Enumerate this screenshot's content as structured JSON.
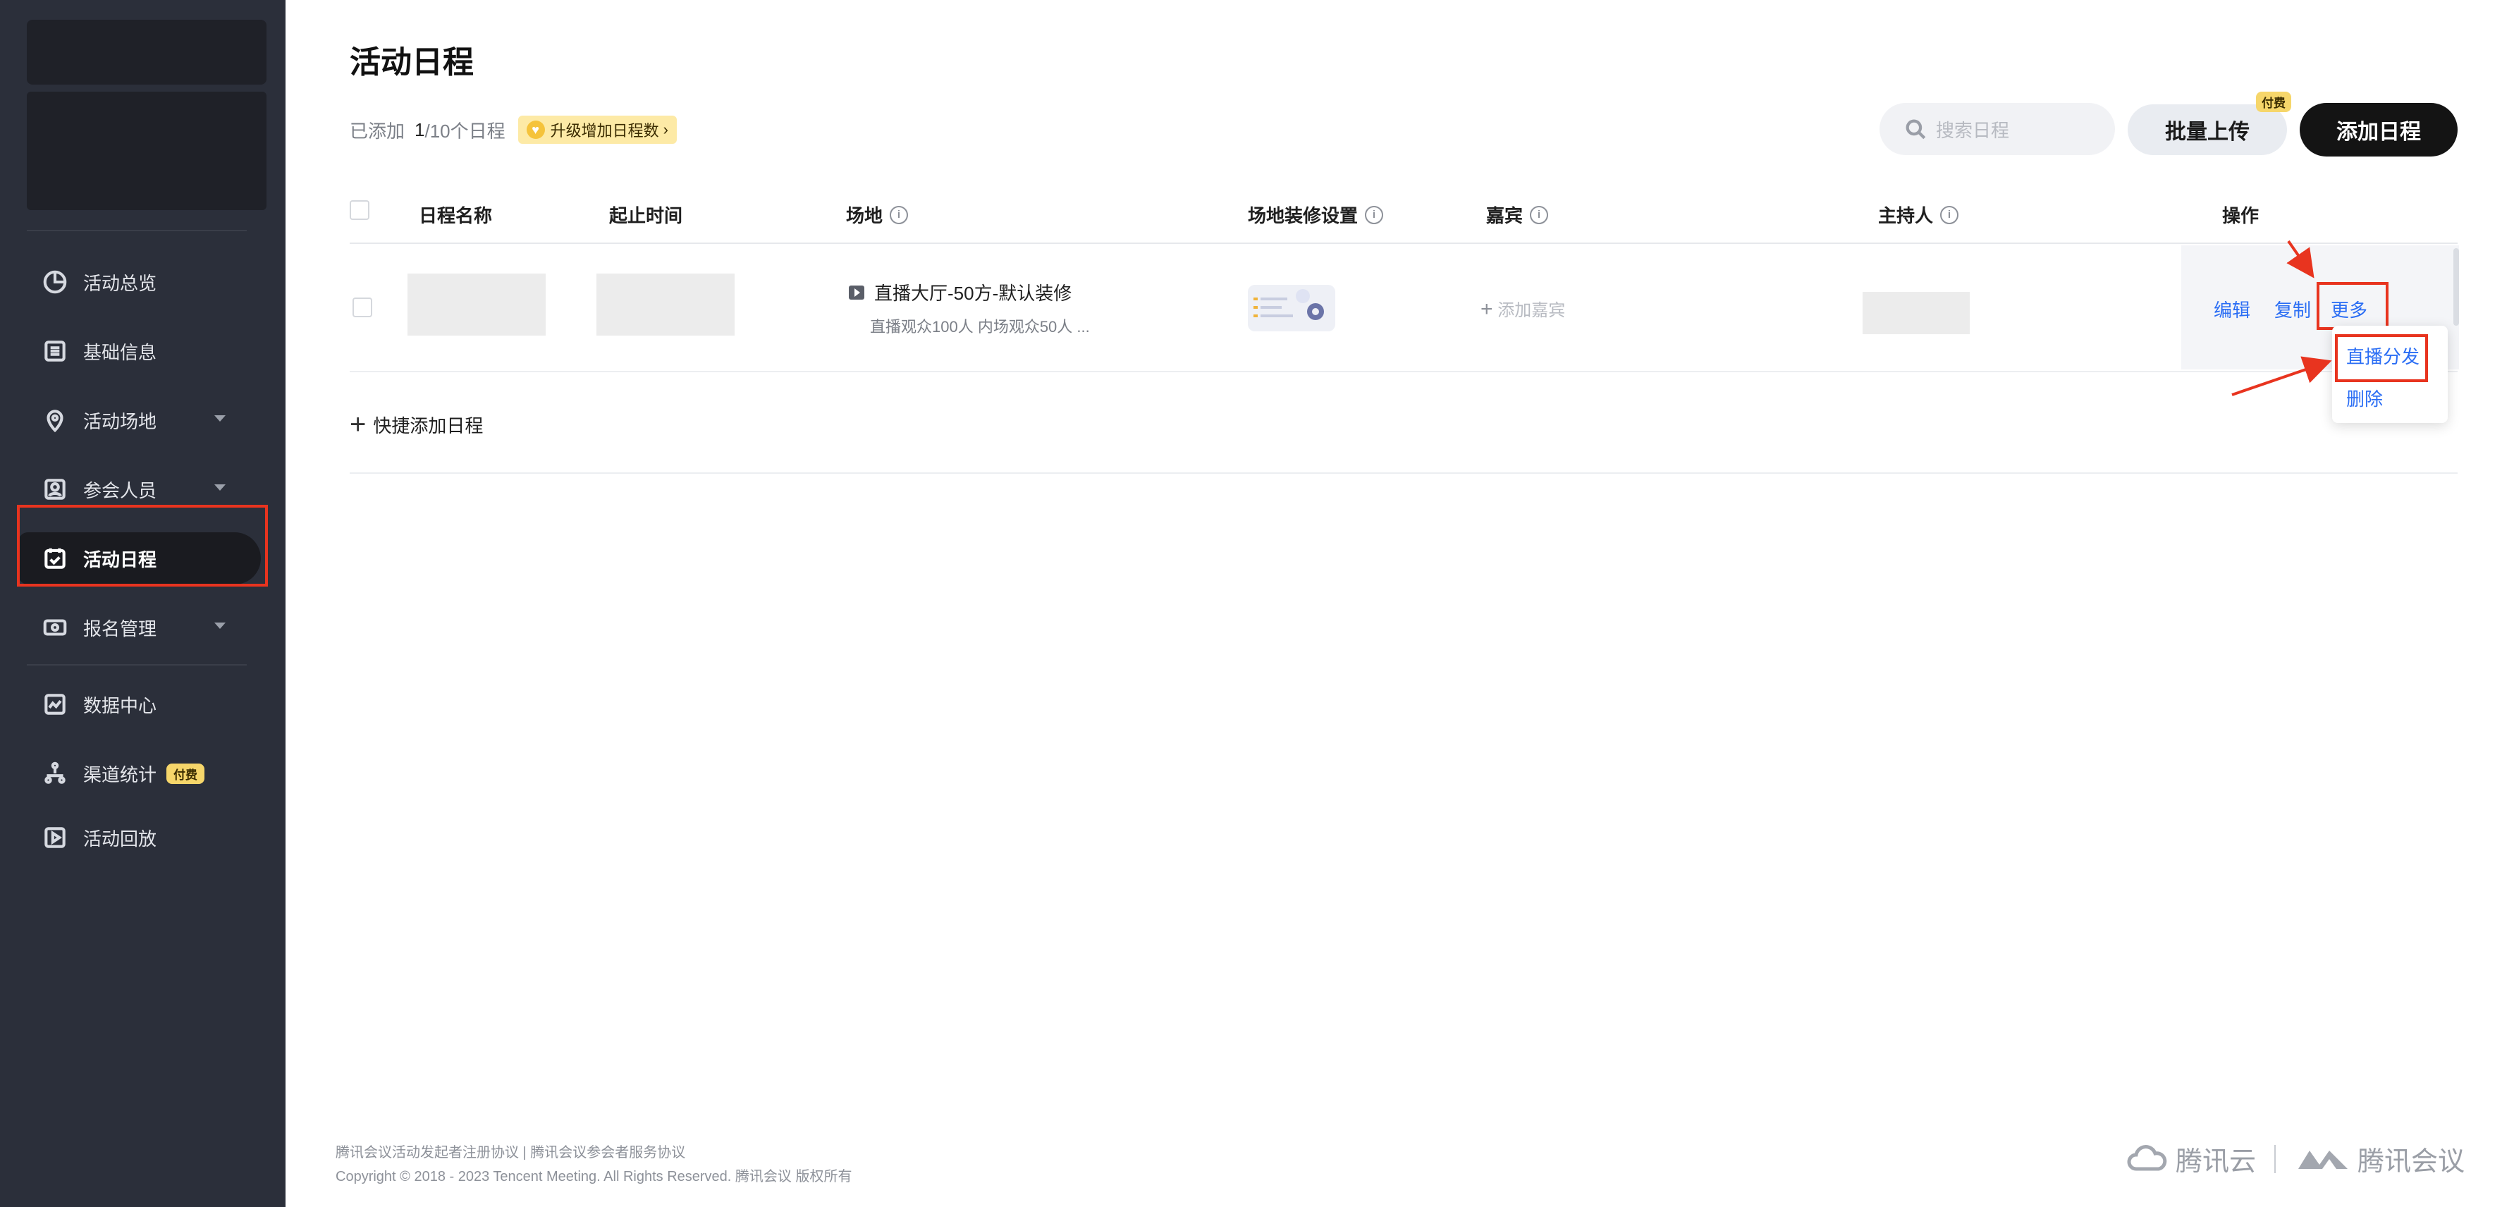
{
  "sidebar": {
    "items": [
      {
        "label": "活动总览",
        "icon": "pie-chart-icon"
      },
      {
        "label": "基础信息",
        "icon": "list-icon"
      },
      {
        "label": "活动场地",
        "icon": "location-pin-icon"
      },
      {
        "label": "参会人员",
        "icon": "person-card-icon"
      },
      {
        "label": "活动日程",
        "icon": "calendar-check-icon"
      },
      {
        "label": "报名管理",
        "icon": "ticket-icon"
      },
      {
        "label": "数据中心",
        "icon": "line-chart-icon"
      },
      {
        "label": "渠道统计",
        "icon": "network-icon"
      },
      {
        "label": "活动回放",
        "icon": "play-icon"
      }
    ],
    "paid_badge": "付费"
  },
  "header": {
    "title": "活动日程",
    "added_prefix": "已添加",
    "count_current": "1",
    "count_total": "/10个日程",
    "upgrade_label": "升级增加日程数",
    "search_placeholder": "搜索日程",
    "upload_label": "批量上传",
    "upload_tag": "付费",
    "add_label": "添加日程"
  },
  "table": {
    "columns": [
      "日程名称",
      "起止时间",
      "场地",
      "场地装修设置",
      "嘉宾",
      "主持人",
      "操作"
    ],
    "rows": [
      {
        "venue_name": "直播大厅-50方-默认装修",
        "venue_detail": "直播观众100人 内场观众50人 ...",
        "add_guest": "添加嘉宾",
        "ops": {
          "edit": "编辑",
          "copy": "复制",
          "more": "更多"
        }
      }
    ]
  },
  "dropdown": {
    "items": [
      "直播分发",
      "删除"
    ]
  },
  "quick_add": "快捷添加日程",
  "footer": {
    "links": "腾讯会议活动发起者注册协议 | 腾讯会议参会者服务协议",
    "copyright": "Copyright © 2018 - 2023 Tencent Meeting. All Rights Reserved. 腾讯会议 版权所有",
    "brand1": "腾讯云",
    "brand2": "腾讯会议"
  },
  "colors": {
    "accent_blue": "#2a6df4",
    "highlight_red": "#e8341f",
    "sidebar_bg": "#2b2f3a"
  }
}
